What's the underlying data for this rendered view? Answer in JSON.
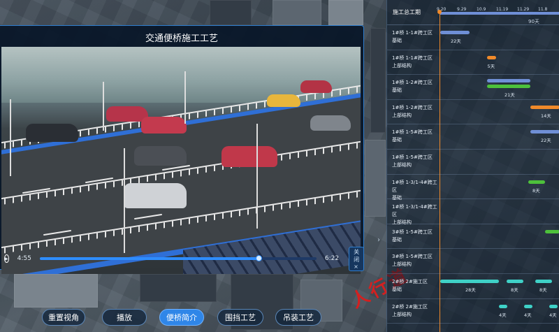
{
  "video": {
    "title": "交通便桥施工工艺",
    "current_time": "4:55",
    "duration": "6:22",
    "progress": 0.79,
    "close_label": "关闭 ×"
  },
  "gantt": {
    "header_label": "施工总工期",
    "dates": [
      "9.20",
      "9.29",
      "10.9",
      "11.19",
      "11.29",
      "11.8"
    ],
    "total_days": "90天",
    "rows": [
      {
        "label": "1#桥 1-1#跨工区\n基础",
        "bars": [
          {
            "color": "#6f8fd6",
            "days": "22天"
          }
        ]
      },
      {
        "label": "1#桥 1-1#跨工区\n上部结构",
        "bars": [
          {
            "color": "#f08a2a",
            "days": "5天"
          }
        ]
      },
      {
        "label": "1#桥 1-2#跨工区\n基础",
        "bars": [
          {
            "color": "#6f8fd6",
            "days": ""
          },
          {
            "color": "#4dc13b",
            "days": "21天"
          }
        ]
      },
      {
        "label": "1#桥 1-2#跨工区\n上部结构",
        "bars": [
          {
            "color": "#f08a2a",
            "days": "14天"
          }
        ]
      },
      {
        "label": "1#桥 1-5#跨工区\n基础",
        "bars": [
          {
            "color": "#6f8fd6",
            "days": "22天"
          }
        ]
      },
      {
        "label": "1#桥 1-5#跨工区\n上部结构",
        "bars": []
      },
      {
        "label": "1#桥 1-3/1-4#跨工区\n基础",
        "bars": [
          {
            "color": "#4dc13b",
            "days": "8天"
          }
        ]
      },
      {
        "label": "1#桥 1-3/1-4#跨工区\n上部结构",
        "bars": []
      },
      {
        "label": "3#桥 1-5#跨工区\n基础",
        "bars": [
          {
            "color": "#4dc13b",
            "days": ""
          }
        ]
      },
      {
        "label": "3#桥 1-5#跨工区\n上部结构",
        "bars": []
      },
      {
        "label": "2#桥 2#施工区\n基础",
        "bars": [
          {
            "color": "#3fd1c7",
            "days": "28天"
          },
          {
            "color": "#3fd1c7",
            "days": "8天"
          },
          {
            "color": "#3fd1c7",
            "days": "8天"
          }
        ]
      },
      {
        "label": "2#桥 2#施工区\n上部结构",
        "bars": [
          {
            "color": "#3fd1c7",
            "days": "4天"
          },
          {
            "color": "#3fd1c7",
            "days": "4天"
          },
          {
            "color": "#3fd1c7",
            "days": "4天"
          }
        ]
      }
    ]
  },
  "toolbar": {
    "buttons": [
      {
        "label": "重置视角",
        "active": false
      },
      {
        "label": "播放",
        "active": false
      },
      {
        "label": "便桥简介",
        "active": true
      },
      {
        "label": "围挡工艺",
        "active": false
      },
      {
        "label": "吊装工艺",
        "active": false
      }
    ]
  },
  "map": {
    "road_marking": "人行道"
  }
}
